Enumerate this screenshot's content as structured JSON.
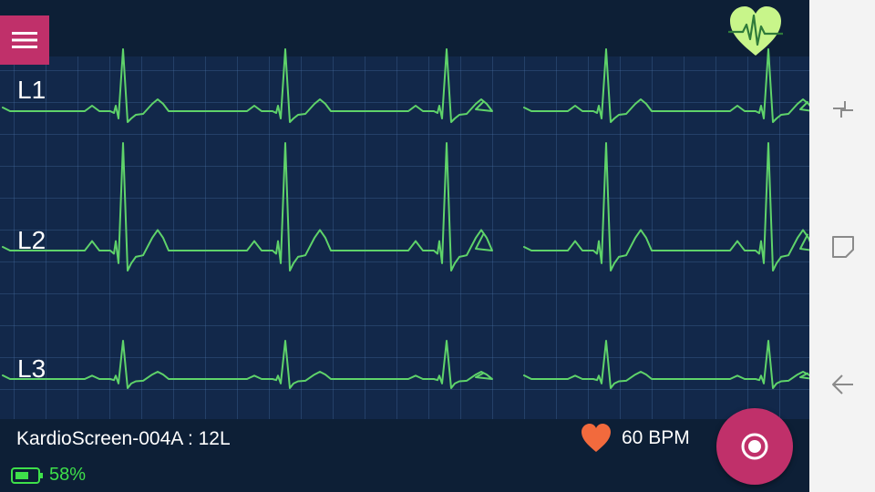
{
  "leads": [
    {
      "label": "L1"
    },
    {
      "label": "L2"
    },
    {
      "label": "L3"
    }
  ],
  "status": {
    "device": "KardioScreen-004A : 12L",
    "battery_percent": "58%",
    "heart_rate": "60 BPM"
  },
  "colors": {
    "trace": "#5fd36a",
    "accent": "#c0306a",
    "battery": "#3ee04a",
    "heart": "#f26a3d",
    "logo_heart": "#c8f58a"
  },
  "icons": {
    "menu": "hamburger-menu-icon",
    "logo": "heart-pulse-icon",
    "bpm": "heart-icon",
    "record": "record-icon",
    "battery": "battery-icon",
    "nav_recent": "recent-apps-icon",
    "nav_home": "home-icon",
    "nav_back": "back-icon"
  }
}
